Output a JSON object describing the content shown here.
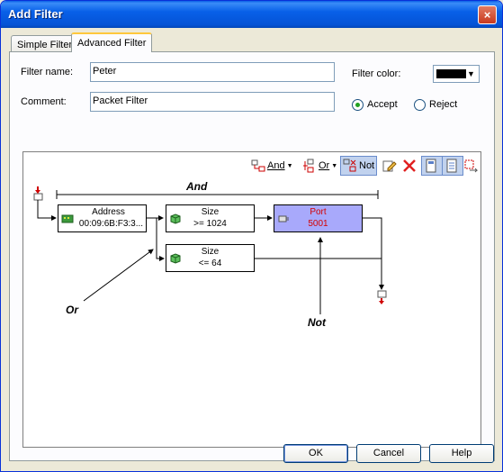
{
  "window": {
    "title": "Add Filter",
    "close_glyph": "×"
  },
  "tabs": [
    {
      "label": "Simple Filter",
      "active": false
    },
    {
      "label": "Advanced Filter",
      "active": true
    }
  ],
  "form": {
    "filter_name_label": "Filter name:",
    "filter_name_value": "Peter",
    "comment_label": "Comment:",
    "comment_value": "Packet Filter",
    "filter_color_label": "Filter color:",
    "filter_color_value": "#000000",
    "accept_label": "Accept",
    "reject_label": "Reject",
    "selected_action": "Accept"
  },
  "toolbar": {
    "and_label": "And",
    "or_label": "Or",
    "not_label": "Not"
  },
  "diagram": {
    "nodes": {
      "address": {
        "title": "Address",
        "value": "00:09:6B:F3:3..."
      },
      "size1": {
        "title": "Size",
        "value": ">= 1024"
      },
      "port": {
        "title": "Port",
        "value": "5001"
      },
      "size2": {
        "title": "Size",
        "value": "<= 64"
      }
    },
    "annotations": {
      "and": "And",
      "or": "Or",
      "not": "Not"
    }
  },
  "buttons": {
    "ok": "OK",
    "cancel": "Cancel",
    "help": "Help"
  }
}
